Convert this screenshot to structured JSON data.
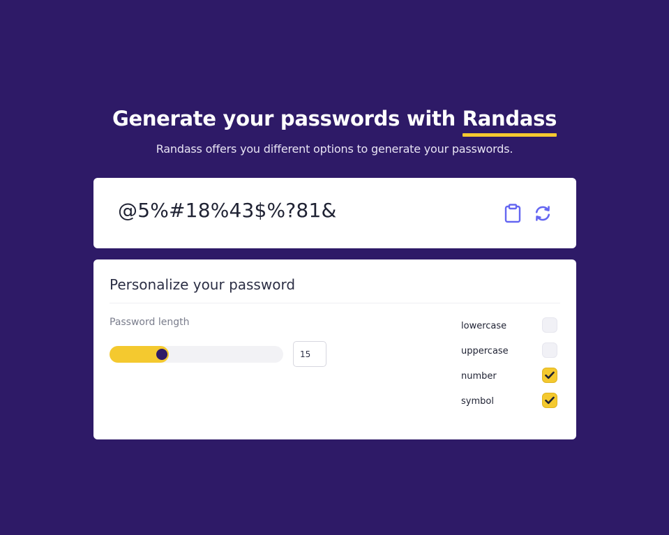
{
  "header": {
    "title_prefix": "Generate your passwords with ",
    "title_brand": "Randass",
    "subtitle": "Randass offers you different options to generate your passwords."
  },
  "password_card": {
    "password": "@5%#18%43$%?81&",
    "copy_icon": "clipboard-icon",
    "refresh_icon": "refresh-icon"
  },
  "options_card": {
    "title": "Personalize your password",
    "length_label": "Password length",
    "length_value": "15",
    "slider_fraction": 0.3,
    "options": [
      {
        "label": "lowercase",
        "checked": false
      },
      {
        "label": "uppercase",
        "checked": false
      },
      {
        "label": "number",
        "checked": true
      },
      {
        "label": "symbol",
        "checked": true
      }
    ]
  },
  "colors": {
    "background": "#2e1a67",
    "accent": "#f4c92f",
    "icon": "#6466f1",
    "card": "#ffffff"
  }
}
